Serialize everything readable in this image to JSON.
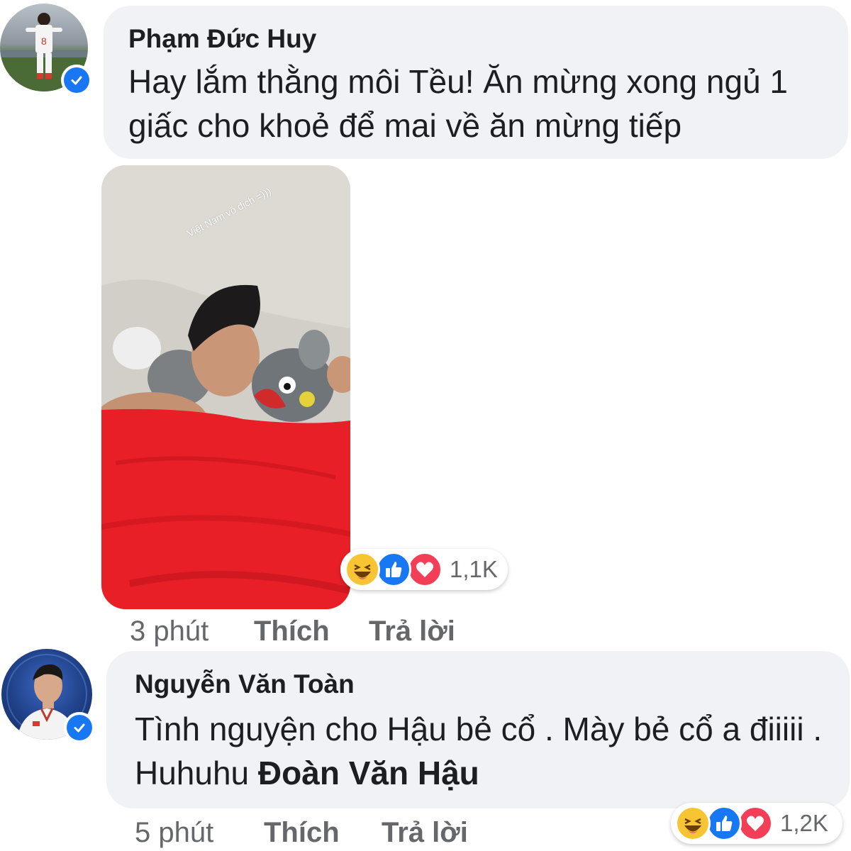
{
  "comments": [
    {
      "author": "Phạm Đức Huy",
      "text": "Hay lắm thằng môi Tều! Ăn mừng xong ngủ 1 giấc cho khoẻ để mai về ăn mừng tiếp",
      "photo_caption": "Việt Nam vô địch =)))",
      "reactions": {
        "icons": [
          "haha-icon",
          "like-icon",
          "love-icon"
        ],
        "count": "1,1K"
      },
      "time": "3 phút",
      "like_label": "Thích",
      "reply_label": "Trả lời"
    },
    {
      "author": "Nguyễn Văn Toàn",
      "text": "Tình nguyện cho Hậu bẻ cổ . Mày bẻ cổ a điiiii . Huhuhu ",
      "mention": "Đoàn Văn Hậu",
      "reactions": {
        "icons": [
          "haha-icon",
          "like-icon",
          "love-icon"
        ],
        "count": "1,2K"
      },
      "time": "5 phút",
      "like_label": "Thích",
      "reply_label": "Trả lời"
    }
  ],
  "colors": {
    "bubble": "#f0f2f5",
    "meta_text": "#65676b",
    "verified": "#1877f2",
    "haha": "#f7c534",
    "like": "#1877f2",
    "love": "#f33e58"
  }
}
